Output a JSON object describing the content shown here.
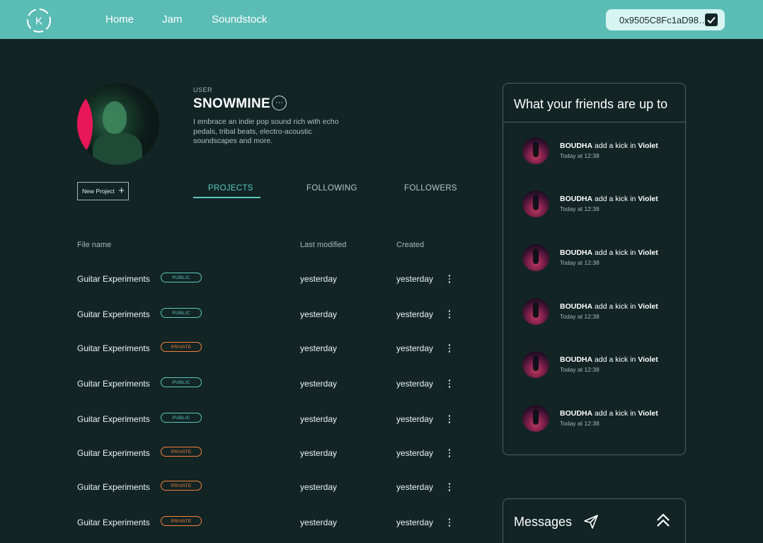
{
  "header": {
    "logo_letter": "K",
    "nav": [
      "Home",
      "Jam",
      "Soundstock"
    ],
    "wallet_address": "0x9505C8Fc1aD98…"
  },
  "profile": {
    "label": "USER",
    "name": "SNOWMINE",
    "bio": "I embrace an indie pop sound rich with echo pedals, tribal beats, electro-acoustic soundscapes and more.",
    "new_project_label": "New Project"
  },
  "tabs": [
    {
      "label": "PROJECTS",
      "active": true
    },
    {
      "label": "FOLLOWING",
      "active": false
    },
    {
      "label": "FOLLOWERS",
      "active": false
    }
  ],
  "table": {
    "columns": [
      "File name",
      "Last modified",
      "Created"
    ],
    "rows": [
      {
        "name": "Guitar Experiments",
        "visibility": "PUBLIC",
        "modified": "yesterday",
        "created": "yesterday"
      },
      {
        "name": "Guitar Experiments",
        "visibility": "PUBLIC",
        "modified": "yesterday",
        "created": "yesterday"
      },
      {
        "name": "Guitar Experiments",
        "visibility": "PRIVATE",
        "modified": "yesterday",
        "created": "yesterday"
      },
      {
        "name": "Guitar Experiments",
        "visibility": "PUBLIC",
        "modified": "yesterday",
        "created": "yesterday"
      },
      {
        "name": "Guitar Experiments",
        "visibility": "PUBLIC",
        "modified": "yesterday",
        "created": "yesterday"
      },
      {
        "name": "Guitar Experiments",
        "visibility": "PRIVATE",
        "modified": "yesterday",
        "created": "yesterday"
      },
      {
        "name": "Guitar Experiments",
        "visibility": "PRIVATE",
        "modified": "yesterday",
        "created": "yesterday"
      },
      {
        "name": "Guitar Experiments",
        "visibility": "PRIVATE",
        "modified": "yesterday",
        "created": "yesterday"
      }
    ]
  },
  "friends": {
    "title": "What your friends are up to",
    "activities": [
      {
        "user": "BOUDHA",
        "action": "add a kick in",
        "target": "Violet",
        "time": "Today at 12:38"
      },
      {
        "user": "BOUDHA",
        "action": "add a kick in",
        "target": "Violet",
        "time": "Today at 12:38"
      },
      {
        "user": "BOUDHA",
        "action": "add a kick in",
        "target": "Violet",
        "time": "Today at 12:38"
      },
      {
        "user": "BOUDHA",
        "action": "add a kick in",
        "target": "Violet",
        "time": "Today at 12:38"
      },
      {
        "user": "BOUDHA",
        "action": "add a kick in",
        "target": "Violet",
        "time": "Today at 12:38"
      },
      {
        "user": "BOUDHA",
        "action": "add a kick in",
        "target": "Violet",
        "time": "Today at 12:38"
      }
    ]
  },
  "messages": {
    "title": "Messages"
  },
  "colors": {
    "accent": "#5bc8c0",
    "topbar": "#5bbcb6",
    "background": "#122424",
    "private": "#f2803a"
  }
}
